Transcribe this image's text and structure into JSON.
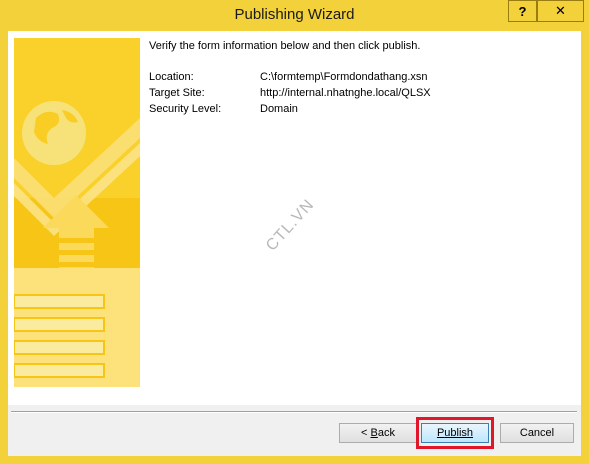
{
  "window": {
    "title": "Publishing Wizard",
    "help_glyph": "?",
    "close_glyph": "✕",
    "accent": "#f3d13a"
  },
  "wizard": {
    "intro": "Verify the form information below and then click publish.",
    "fields": [
      {
        "label": "Location:",
        "value": "C:\\formtemp\\Formdondathang.xsn"
      },
      {
        "label": "Target Site:",
        "value": "http://internal.nhatnghe.local/QLSX"
      },
      {
        "label": "Security Level:",
        "value": "Domain"
      }
    ],
    "watermark": "CTL.VN"
  },
  "buttons": {
    "back_prefix": "< ",
    "back_key": "B",
    "back_rest": "ack",
    "publish_key": "P",
    "publish_rest": "ublish",
    "cancel": "Cancel",
    "highlight_color": "#e2162a"
  },
  "icons": [
    "help-icon",
    "close-icon",
    "globe-icon",
    "checkmark-icon",
    "arrow-up-icon",
    "form-icon"
  ]
}
